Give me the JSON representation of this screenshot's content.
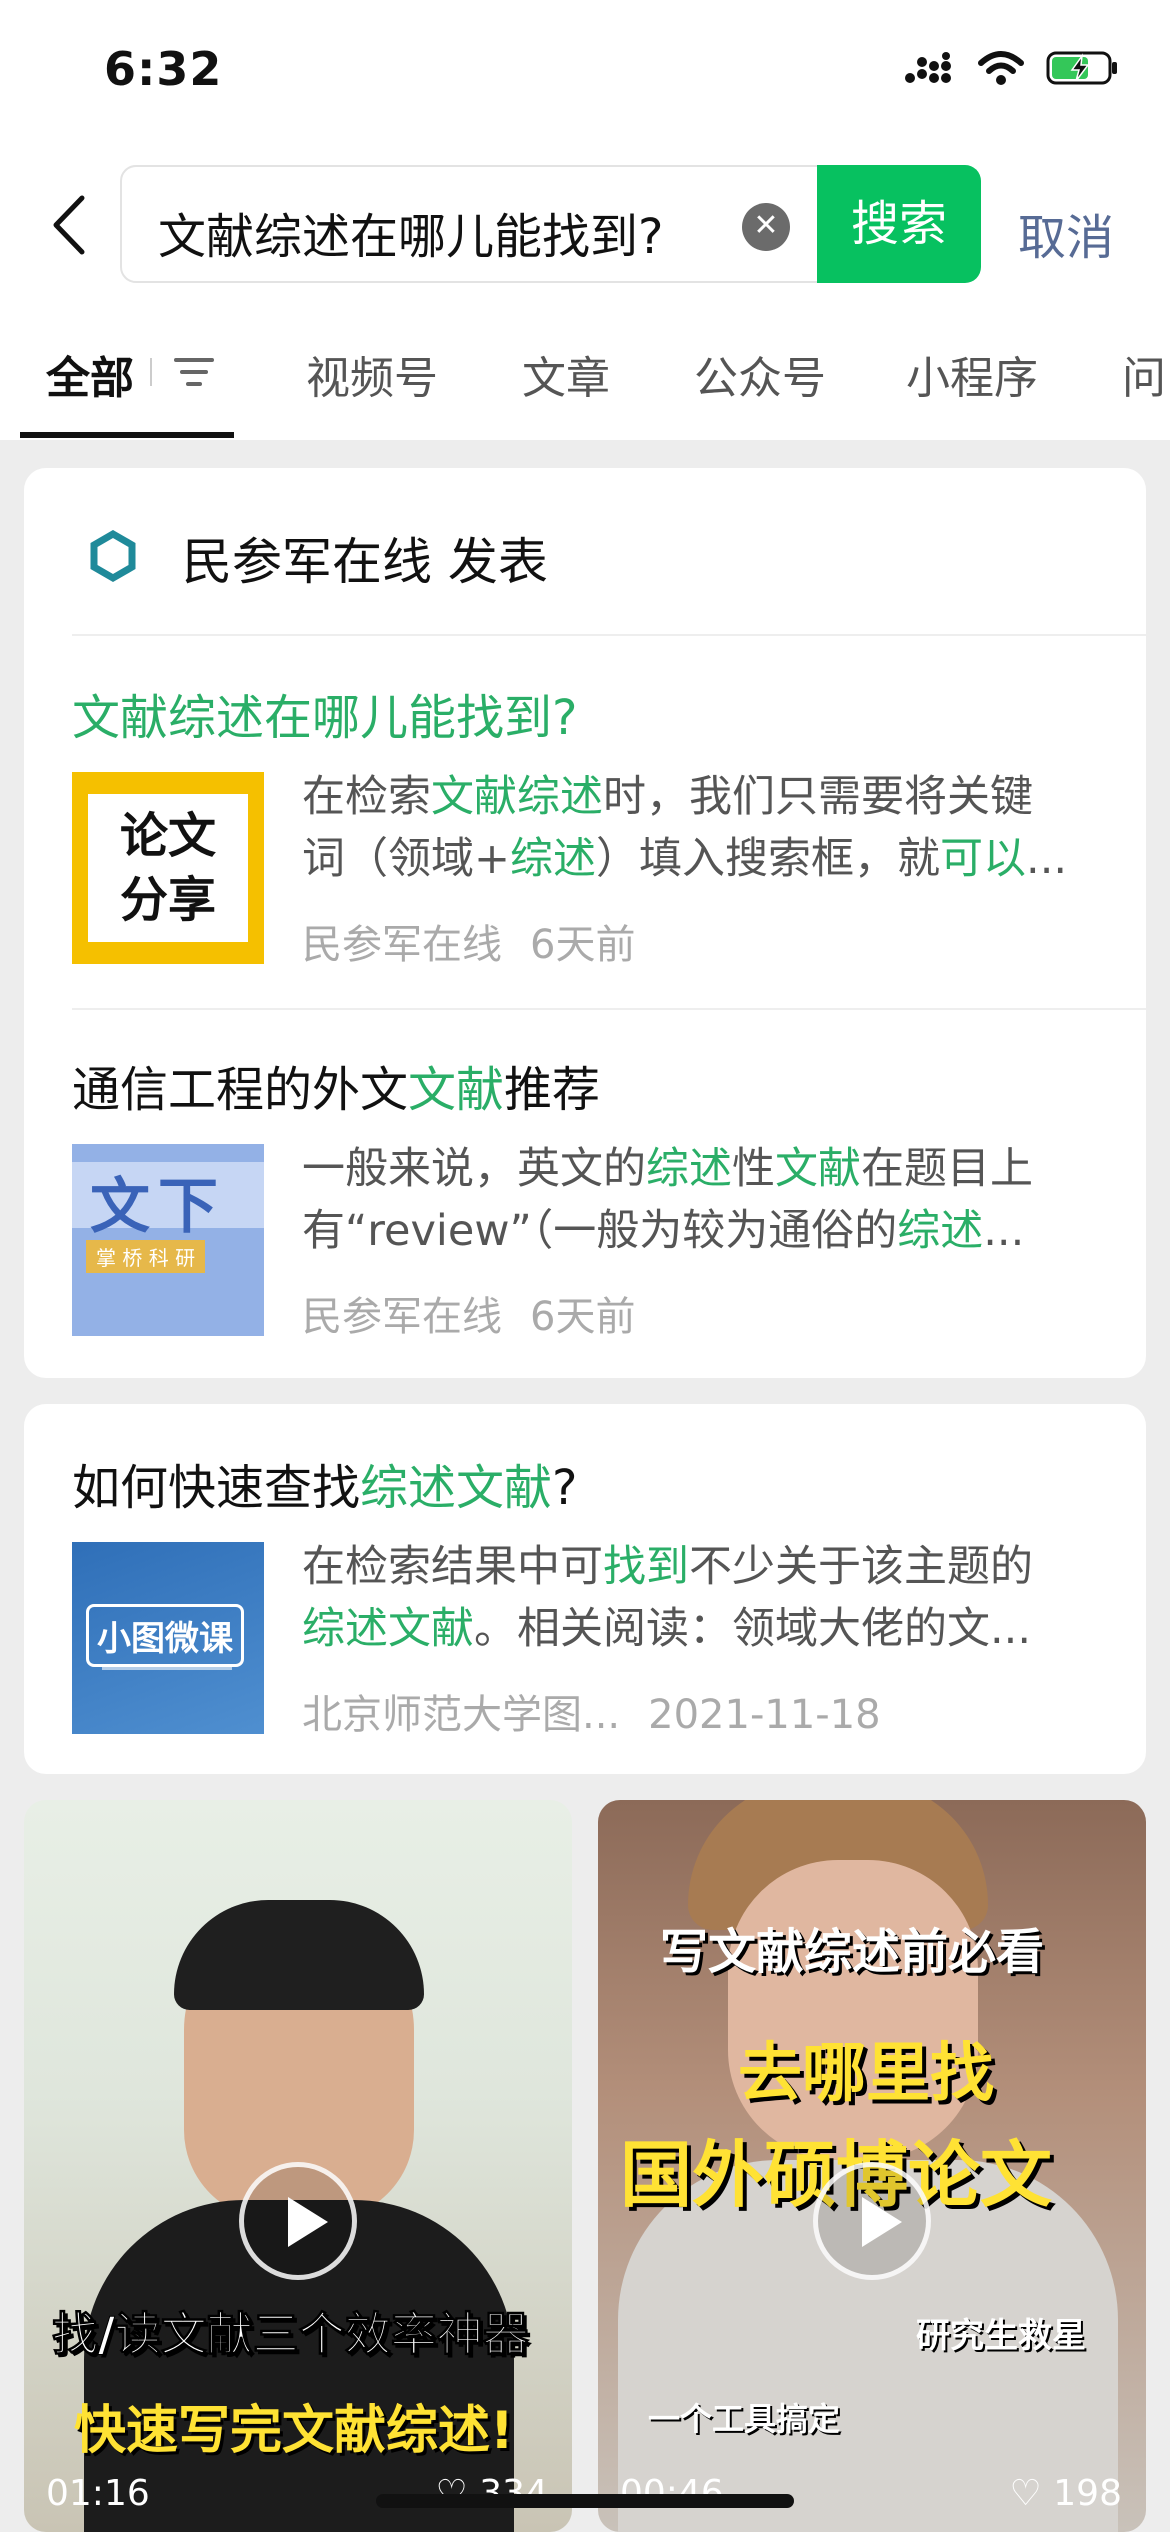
{
  "status_bar": {
    "time": "6:32"
  },
  "search": {
    "query": "文献综述在哪儿能找到?",
    "button": "搜索",
    "cancel": "取消"
  },
  "tabs": [
    {
      "label": "全部",
      "active": true
    },
    {
      "label": "视频号"
    },
    {
      "label": "文章"
    },
    {
      "label": "公众号"
    },
    {
      "label": "小程序"
    },
    {
      "label": "问"
    }
  ],
  "card1": {
    "source": "民参军在线 发表",
    "results": [
      {
        "title_parts": [
          "文献综述在哪儿能找到?"
        ],
        "thumb_text": [
          "论文",
          "分享"
        ],
        "snippet_line1": "在检索文献综述时，我们只需要将关键",
        "snippet_line2": "词（领域+综述）填入搜索框，就可以...",
        "author": "民参军在线",
        "time": "6天前"
      },
      {
        "title_a": "通信工程的外文",
        "title_b": "文献",
        "title_c": "推荐",
        "thumb_text": [
          "文下",
          "掌 桥 科 研"
        ],
        "snippet_line1": "一般来说，英文的综述性文献在题目上",
        "snippet_line2": "有“review”（一般为较为通俗的综述...",
        "author": "民参军在线",
        "time": "6天前"
      }
    ]
  },
  "card2": {
    "title_a": "如何快速查找",
    "title_b": "综述文献",
    "title_c": "?",
    "thumb_text": "小图微课",
    "snippet_line1": "在检索结果中可找到不少关于该主题的",
    "snippet_line2": "综述文献。相关阅读：领域大佬的文...",
    "author": "北京师范大学图...",
    "time": "2021-11-18"
  },
  "videos": [
    {
      "line1": "找/读文献三个效率神器",
      "line2": "快速写完文献综述!",
      "duration": "01:16",
      "likes": "334"
    },
    {
      "line1": "写文献综述前必看",
      "line2": "去哪里找",
      "line3": "国外硕博论文",
      "line4": "研究生救星",
      "line5": "一个工具搞定",
      "duration": "00:46",
      "likes": "198"
    }
  ],
  "colors": {
    "accent": "#07c160",
    "highlight": "#2aae67",
    "link": "#576b95"
  }
}
